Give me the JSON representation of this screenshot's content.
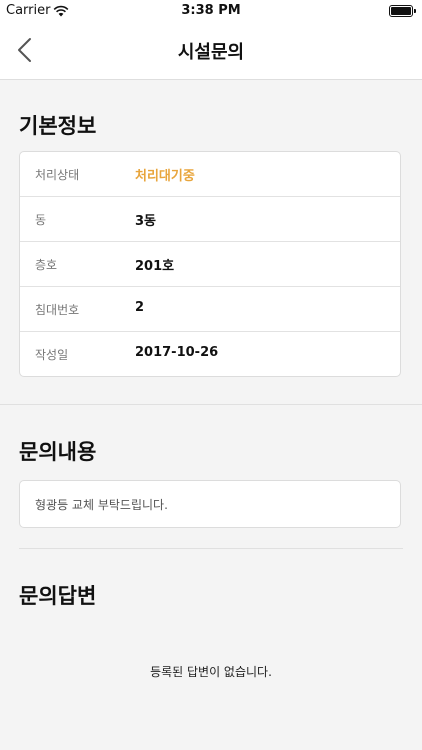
{
  "status_bar": {
    "carrier": "Carrier",
    "time": "3:38 PM",
    "icons": [
      "wifi-icon",
      "battery-icon"
    ]
  },
  "nav": {
    "title": "시설문의",
    "back_icon": "chevron-left-icon"
  },
  "basic_info": {
    "heading": "기본정보",
    "rows": [
      {
        "label": "처리상태",
        "value": "처리대기중"
      },
      {
        "label": "동",
        "value": "3동"
      },
      {
        "label": "층호",
        "value": "201호"
      },
      {
        "label": "침대번호",
        "value": "2"
      },
      {
        "label": "작성일",
        "value": "2017-10-26"
      }
    ]
  },
  "inquiry": {
    "heading": "문의내용",
    "content": "형광등 교체 부탁드립니다."
  },
  "answer": {
    "heading": "문의답변",
    "empty_message": "등록된 답변이 없습니다."
  },
  "colors": {
    "status_accent": "#e8a53c",
    "background": "#f4f4f4"
  }
}
